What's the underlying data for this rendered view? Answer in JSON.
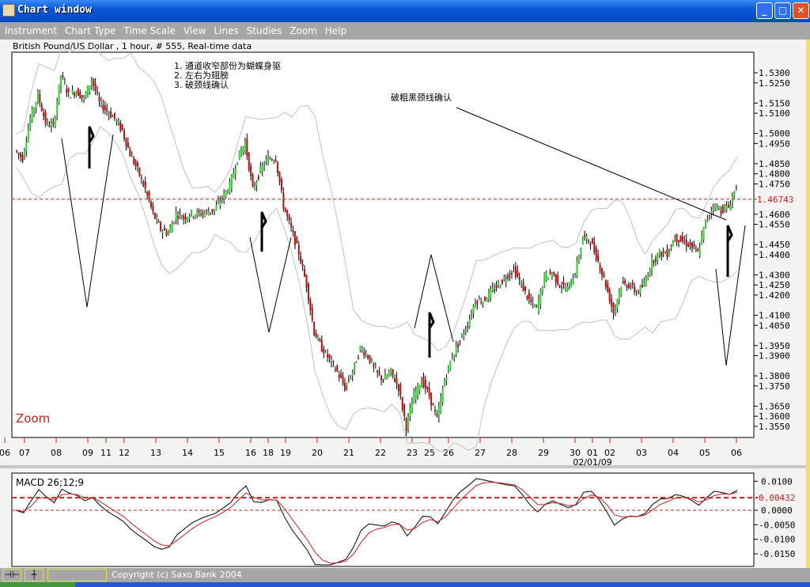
{
  "window": {
    "title": "Chart window",
    "minimize": "_",
    "maximize": "□",
    "close": "✕",
    "icon": "java-cup-icon"
  },
  "menu": [
    "Instrument",
    "Chart Type",
    "Time Scale",
    "View",
    "Lines",
    "Studies",
    "Zoom",
    "Help"
  ],
  "info": "British Pound/US Dollar , 1 hour, # 555, Real-time data",
  "annotations": {
    "notes": [
      "1.  通道收窄部份为蝴蝶身驱",
      "2.  左右为翅膀",
      "3.  破颈线确认"
    ],
    "neckline": "破粗黑颈线确认",
    "zoom": "Zoom"
  },
  "status": {
    "copyright": "Copyright (c) Saxo Bank 2004",
    "btn1": "⊣⊢",
    "btn2": "┼"
  },
  "colors": {
    "up": "#33cc33",
    "down": "#b01010",
    "ref": "#d02020",
    "band": "#c0c0c0"
  },
  "chart_data": [
    {
      "type": "line",
      "title": "British Pound/US Dollar , 1 hour",
      "ylim": [
        1.35,
        1.54
      ],
      "yticks": [
        "1.5300",
        "1.5250",
        "1.5150",
        "1.5100",
        "1.5000",
        "1.4950",
        "1.4850",
        "1.4800",
        "1.4750",
        "1.4600",
        "1.4550",
        "1.4450",
        "1.4400",
        "1.4300",
        "1.4250",
        "1.4200",
        "1.4100",
        "1.4050",
        "1.3950",
        "1.3900",
        "1.3800",
        "1.3750",
        "1.3650",
        "1.3600",
        "1.3550"
      ],
      "last_price": "1.46743",
      "xticks": [
        "06",
        "07",
        "08",
        "09",
        "11",
        "12",
        "13",
        "14",
        "15",
        "16",
        "18",
        "19",
        "20",
        "21",
        "22",
        "23",
        "25",
        "26",
        "27",
        "28",
        "29",
        "30",
        "01",
        "02",
        "03",
        "04",
        "05",
        "06"
      ],
      "xsublabel": "02/01/09",
      "close": [
        1.4916,
        1.4877,
        1.5073,
        1.519,
        1.5053,
        1.5034,
        1.5288,
        1.519,
        1.521,
        1.5171,
        1.5269,
        1.5151,
        1.5112,
        1.5073,
        1.5014,
        1.4897,
        1.4818,
        1.4721,
        1.4603,
        1.4525,
        1.4505,
        1.4603,
        1.4583,
        1.4603,
        1.4603,
        1.4611,
        1.4623,
        1.4681,
        1.474,
        1.4877,
        1.4955,
        1.4721,
        1.4818,
        1.4877,
        1.4877,
        1.4642,
        1.4525,
        1.4407,
        1.4251,
        1.4016,
        1.3937,
        1.3879,
        1.382,
        1.3742,
        1.382,
        1.3937,
        1.3898,
        1.382,
        1.3781,
        1.382,
        1.3742,
        1.3546,
        1.3703,
        1.3781,
        1.3703,
        1.3585,
        1.3781,
        1.3898,
        1.3977,
        1.4055,
        1.4172,
        1.4172,
        1.4212,
        1.4251,
        1.429,
        1.4329,
        1.4251,
        1.4172,
        1.4133,
        1.429,
        1.4309,
        1.4251,
        1.4231,
        1.4309,
        1.4486,
        1.4466,
        1.4368,
        1.4251,
        1.4114,
        1.4251,
        1.4251,
        1.4212,
        1.4251,
        1.4368,
        1.4407,
        1.4407,
        1.4486,
        1.4466,
        1.4446,
        1.4407,
        1.4564,
        1.4642,
        1.4623,
        1.4634,
        1.474
      ]
    },
    {
      "type": "line",
      "title": "MACD 26;12;9",
      "ylim": [
        -0.018,
        0.012
      ],
      "yticks": [
        "0.0100",
        "0.0000",
        "-0.0050",
        "-0.0100",
        "-0.0150"
      ],
      "last_value": "0.00432",
      "series": [
        "MACD",
        "Signal"
      ]
    }
  ]
}
